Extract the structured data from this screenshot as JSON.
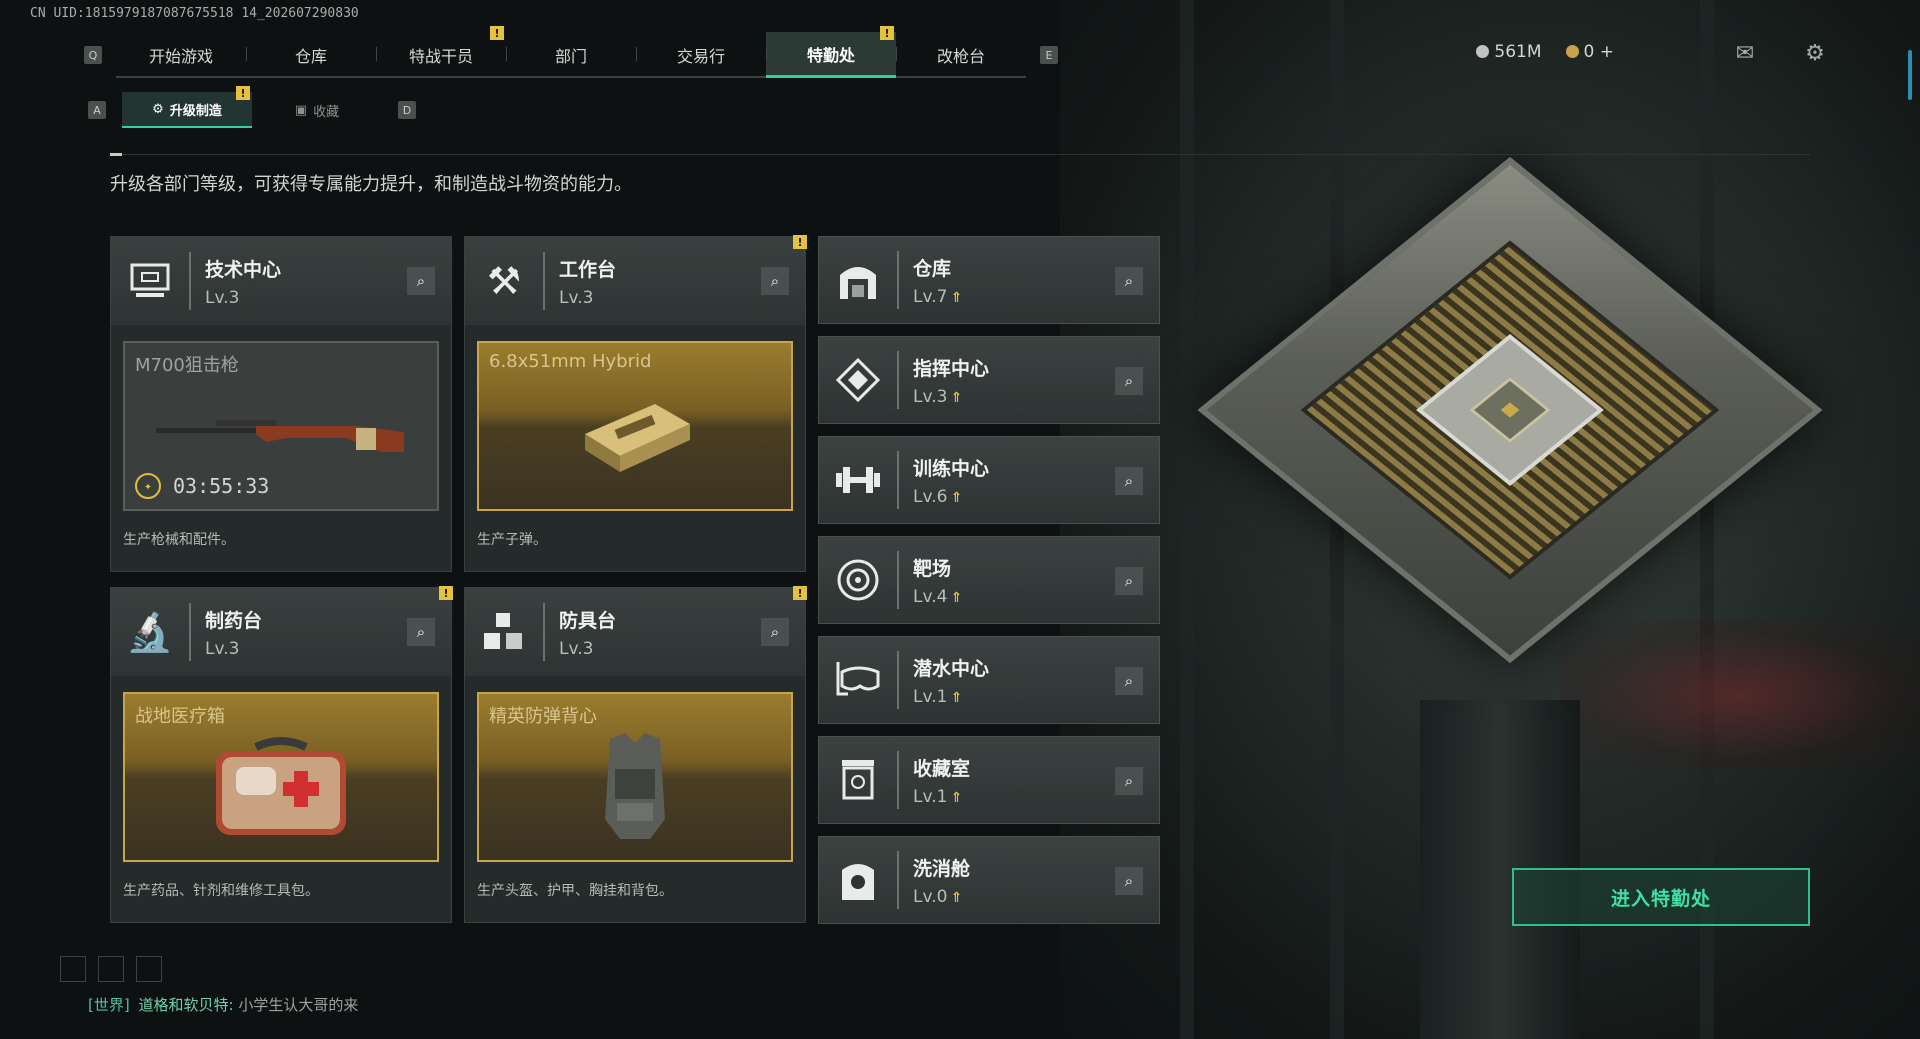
{
  "uid": "CN UID:1815979187087675518 14_202607290830",
  "nav": {
    "left_key": "Q",
    "right_key": "E",
    "tabs": [
      {
        "label": "开始游戏",
        "active": false,
        "alert": false
      },
      {
        "label": "仓库",
        "active": false,
        "alert": false
      },
      {
        "label": "特战干员",
        "active": false,
        "alert": true
      },
      {
        "label": "部门",
        "active": false,
        "alert": false
      },
      {
        "label": "交易行",
        "active": false,
        "alert": false
      },
      {
        "label": "特勤处",
        "active": true,
        "alert": true
      },
      {
        "label": "改枪台",
        "active": false,
        "alert": false
      }
    ]
  },
  "subnav": {
    "left_key": "A",
    "right_key": "D",
    "tabs": [
      {
        "label": "升级制造",
        "active": true
      },
      {
        "label": "收藏",
        "active": false
      }
    ]
  },
  "currency": {
    "silver": "561M",
    "gold": "0",
    "add": "+"
  },
  "icons": {
    "mail": "mail-icon",
    "settings": "gear-icon"
  },
  "description": "升级各部门等级，可获得专属能力提升，和制造战斗物资的能力。",
  "workshops": [
    {
      "title": "技术中心",
      "level": "Lv.3",
      "product": "M700狙击枪",
      "timer": "03:55:33",
      "desc": "生产枪械和配件。",
      "gold": false,
      "alert": false
    },
    {
      "title": "工作台",
      "level": "Lv.3",
      "product": "6.8x51mm Hybrid",
      "timer": "",
      "desc": "生产子弹。",
      "gold": true,
      "alert": true
    },
    {
      "title": "制药台",
      "level": "Lv.3",
      "product": "战地医疗箱",
      "timer": "",
      "desc": "生产药品、针剂和维修工具包。",
      "gold": true,
      "alert": true
    },
    {
      "title": "防具台",
      "level": "Lv.3",
      "product": "精英防弹背心",
      "timer": "",
      "desc": "生产头盔、护甲、胸挂和背包。",
      "gold": true,
      "alert": true
    }
  ],
  "facilities": [
    {
      "title": "仓库",
      "level": "Lv.7",
      "icon": "warehouse-icon"
    },
    {
      "title": "指挥中心",
      "level": "Lv.3",
      "icon": "command-icon"
    },
    {
      "title": "训练中心",
      "level": "Lv.6",
      "icon": "dumbbell-icon"
    },
    {
      "title": "靶场",
      "level": "Lv.4",
      "icon": "target-icon"
    },
    {
      "title": "潜水中心",
      "level": "Lv.1",
      "icon": "diving-mask-icon"
    },
    {
      "title": "收藏室",
      "level": "Lv.1",
      "icon": "collection-icon"
    },
    {
      "title": "洗消舱",
      "level": "Lv.0",
      "icon": "decontamination-icon"
    }
  ],
  "enter_button": "进入特勤处",
  "chat": {
    "channel": "[世界]",
    "name": "道格和软贝特:",
    "message": "小学生认大哥的来"
  },
  "colors": {
    "accent": "#33d199",
    "alert": "#e5c23e",
    "gold_border": "#c8a44a"
  }
}
